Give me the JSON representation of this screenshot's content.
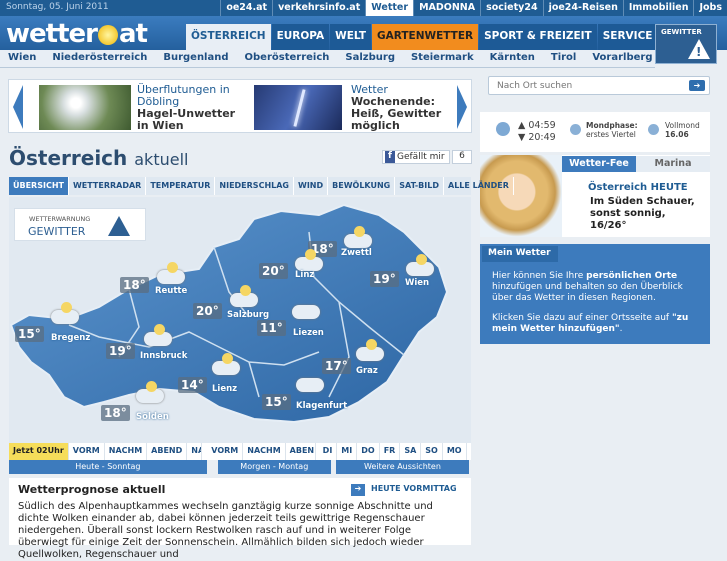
{
  "topbar": {
    "date": "Sonntag, 05. Juni 2011",
    "links": [
      "oe24.at",
      "verkehrsinfo.at",
      "Wetter",
      "MADONNA",
      "society24",
      "joe24-Reisen",
      "Immobilien",
      "Jobs"
    ]
  },
  "logo": {
    "text_a": "wetter",
    "text_b": "at"
  },
  "mainnav": [
    "ÖSTERREICH",
    "EUROPA",
    "WELT",
    "GARTENWETTER",
    "SPORT & FREIZEIT",
    "SERVICE"
  ],
  "gewitter_button": {
    "label": "GEWITTER"
  },
  "regions": [
    "Wien",
    "Niederösterreich",
    "Burgenland",
    "Oberösterreich",
    "Salzburg",
    "Steiermark",
    "Kärnten",
    "Tirol",
    "Vorarlberg"
  ],
  "teasers": [
    {
      "headline": "Überflutungen in Döbling",
      "sub": "Hagel-Unwetter in Wien"
    },
    {
      "headline": "Wetter",
      "sub": "Wochenende: Heiß, Gewitter möglich"
    }
  ],
  "search": {
    "placeholder": "Nach Ort suchen"
  },
  "sun": {
    "rise": "04:59",
    "set": "20:49"
  },
  "moon": {
    "phase_label": "Mondphase:",
    "phase_value": "erstes Viertel",
    "full_label": "Vollmond",
    "full_date": "16.06"
  },
  "fee": {
    "tab_active": "Wetter-Fee",
    "tab_other": "Marina",
    "heading": "Österreich HEUTE",
    "text": "Im Süden Schauer, sonst sonnig, 16/26°"
  },
  "mein_wetter": {
    "tab": "Mein Wetter",
    "p1_a": "Hier können Sie Ihre ",
    "p1_b": "persönlichen Orte",
    "p1_c": " hinzufügen und behalten so den Überblick über das Wetter in diesen Regionen.",
    "p2_a": "Klicken Sie dazu auf einer Ortsseite auf ",
    "p2_b": "\"zu mein Wetter hinzufügen\"",
    "p2_c": "."
  },
  "page_title": {
    "main": "Österreich",
    "sub": "aktuell"
  },
  "facebook": {
    "label": "Gefällt mir",
    "count": "6"
  },
  "map_tabs": [
    "ÜBERSICHT",
    "WETTERRADAR",
    "TEMPERATUR",
    "NIEDERSCHLAG",
    "WIND",
    "BEWÖLKUNG",
    "SAT-BILD",
    "ALLE LÄNDER"
  ],
  "warning": {
    "small": "WETTERWARNUNG",
    "big": "GEWITTER"
  },
  "cities": [
    {
      "name": "Zwettl",
      "temp": "18°"
    },
    {
      "name": "Linz",
      "temp": "20°"
    },
    {
      "name": "Wien",
      "temp": "19°"
    },
    {
      "name": "Reutte",
      "temp": "18°"
    },
    {
      "name": "Salzburg",
      "temp": "20°"
    },
    {
      "name": "Liezen",
      "temp": "11°"
    },
    {
      "name": "Bregenz",
      "temp": "15°"
    },
    {
      "name": "Innsbruck",
      "temp": "19°"
    },
    {
      "name": "Lienz",
      "temp": "14°"
    },
    {
      "name": "Graz",
      "temp": "17°"
    },
    {
      "name": "Klagenfurt",
      "temp": "15°"
    },
    {
      "name": "Sölden",
      "temp": "18°"
    }
  ],
  "timeline": [
    "Jetzt 02Uhr",
    "VORM",
    "NACHM",
    "ABEND",
    "NA",
    "VORM",
    "NACHM",
    "ABEN",
    "DI",
    "MI",
    "DO",
    "FR",
    "SA",
    "SO",
    "MO"
  ],
  "periods": [
    "Heute - Sonntag",
    "Morgen - Montag",
    "Weitere Aussichten"
  ],
  "prognose": {
    "heading": "Wetterprognose aktuell",
    "link": "HEUTE VORMITTAG",
    "text": "Südlich des Alpenhauptkammes wechseln ganztägig kurze sonnige Abschnitte und dichte Wolken einander ab, dabei können jederzeit teils gewittrige Regenschauer niedergehen. Überall sonst lockern Restwolken rasch auf und in weiterer Folge überwiegt für einige Zeit der Sonnenschein. Allmählich bilden sich jedoch wieder Quellwolken, Regenschauer und"
  }
}
